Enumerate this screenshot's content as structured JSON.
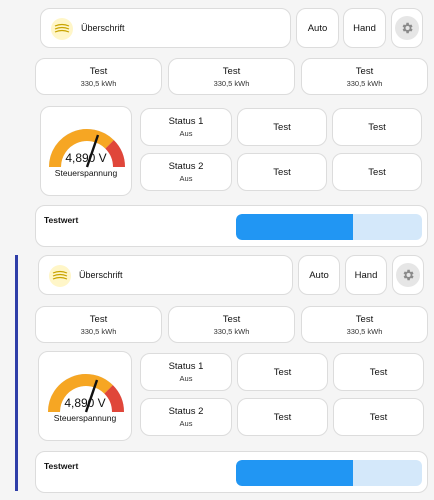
{
  "sections": [
    {
      "header": {
        "title": "Überschrift",
        "auto_label": "Auto",
        "hand_label": "Hand"
      },
      "energy_tiles": [
        {
          "label": "Test",
          "value": "330,5 kWh"
        },
        {
          "label": "Test",
          "value": "330,5 kWh"
        },
        {
          "label": "Test",
          "value": "330,5 kWh"
        }
      ],
      "gauge": {
        "value_text": "4,890 V",
        "label": "Steuerspannung",
        "fraction": 0.62
      },
      "status_tiles": [
        {
          "label": "Status 1",
          "sub": "Aus"
        },
        {
          "label": "Test",
          "sub": ""
        },
        {
          "label": "Test",
          "sub": ""
        },
        {
          "label": "Status 2",
          "sub": "Aus"
        },
        {
          "label": "Test",
          "sub": ""
        },
        {
          "label": "Test",
          "sub": ""
        }
      ],
      "testwert": {
        "label": "Testwert",
        "fraction": 0.63
      }
    },
    {
      "header": {
        "title": "Überschrift",
        "auto_label": "Auto",
        "hand_label": "Hand"
      },
      "energy_tiles": [
        {
          "label": "Test",
          "value": "330,5 kWh"
        },
        {
          "label": "Test",
          "value": "330,5 kWh"
        },
        {
          "label": "Test",
          "value": "330,5 kWh"
        }
      ],
      "gauge": {
        "value_text": "4,890 V",
        "label": "Steuerspannung",
        "fraction": 0.62
      },
      "status_tiles": [
        {
          "label": "Status 1",
          "sub": "Aus"
        },
        {
          "label": "Test",
          "sub": ""
        },
        {
          "label": "Test",
          "sub": ""
        },
        {
          "label": "Status 2",
          "sub": "Aus"
        },
        {
          "label": "Test",
          "sub": ""
        },
        {
          "label": "Test",
          "sub": ""
        }
      ],
      "testwert": {
        "label": "Testwert",
        "fraction": 0.63
      }
    }
  ],
  "colors": {
    "bar_fill": "#2196f3",
    "bar_track": "#d4e8fa",
    "gauge_amber": "#f6a623",
    "gauge_red": "#e0463a",
    "gauge_gray": "#dcdcdc",
    "accent_line": "#2f3ea8"
  }
}
